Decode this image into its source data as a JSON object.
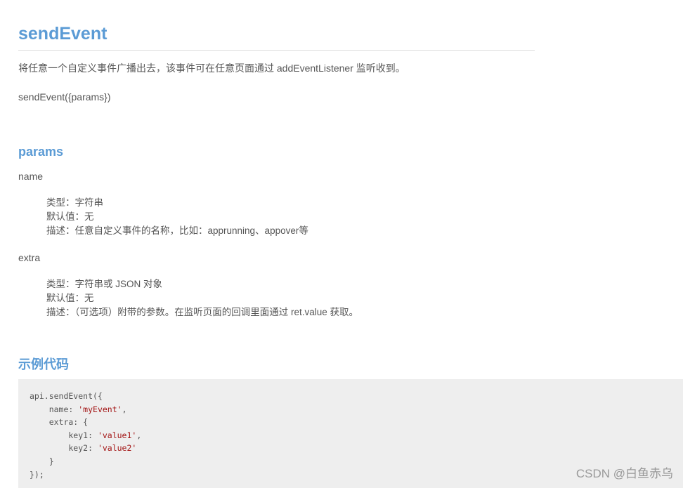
{
  "doc": {
    "title": "sendEvent",
    "description": "将任意一个自定义事件广播出去，该事件可在任意页面通过 addEventListener 监听收到。",
    "signature": "sendEvent({params})"
  },
  "params": {
    "heading": "params",
    "items": [
      {
        "name": "name",
        "type": "类型：字符串",
        "default": "默认值：无",
        "desc": "描述：任意自定义事件的名称，比如：apprunning、appover等"
      },
      {
        "name": "extra",
        "type": "类型：字符串或 JSON 对象",
        "default": "默认值：无",
        "desc": "描述：（可选项）附带的参数。在监听页面的回调里面通过 ret.value 获取。"
      }
    ]
  },
  "example": {
    "heading": "示例代码",
    "code": {
      "line1": "api.sendEvent({",
      "name_key": "    name: ",
      "name_val": "'myEvent'",
      "name_tail": ",",
      "extra_open": "    extra: {",
      "key1_key": "        key1: ",
      "key1_val": "'value1'",
      "key1_tail": ",",
      "key2_key": "        key2: ",
      "key2_val": "'value2'",
      "extra_close": "    }",
      "end": "});"
    }
  },
  "watermark": "CSDN @白鱼赤乌",
  "colors": {
    "heading": "#5B9BD5",
    "text": "#555555",
    "code_bg": "#eeeeee",
    "code_string": "#a31515"
  }
}
